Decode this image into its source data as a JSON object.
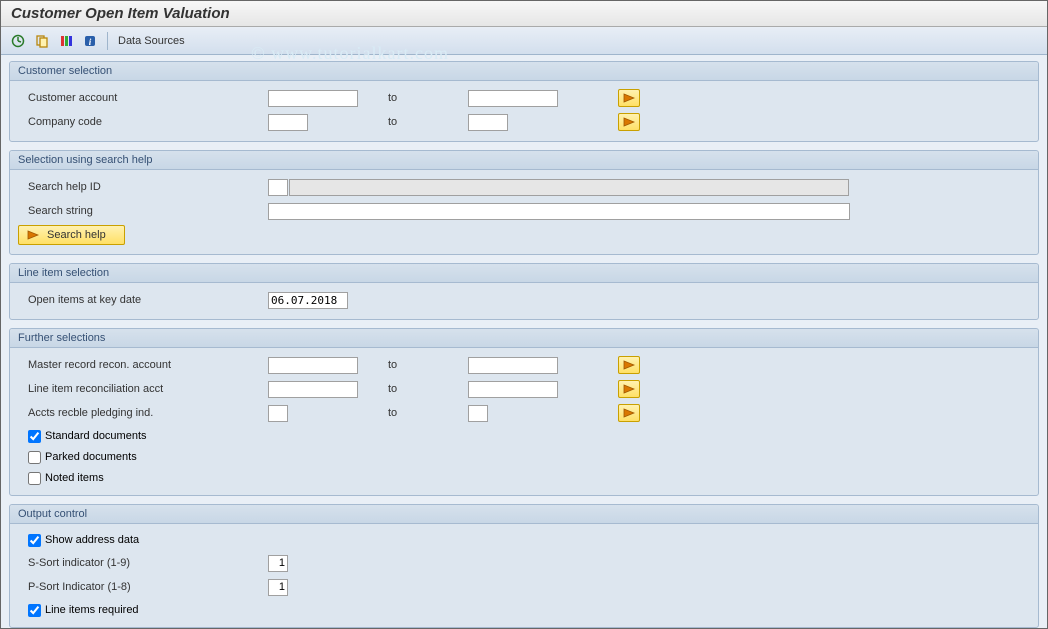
{
  "title": "Customer Open Item Valuation",
  "toolbar": {
    "data_sources": "Data Sources"
  },
  "watermark": "© www.tutorialkart.com",
  "groups": {
    "customer_selection": {
      "title": "Customer selection",
      "customer_account_label": "Customer account",
      "company_code_label": "Company code",
      "to_label": "to"
    },
    "search_help": {
      "title": "Selection using search help",
      "search_help_id_label": "Search help ID",
      "search_string_label": "Search string",
      "search_help_btn": "Search help"
    },
    "line_item_selection": {
      "title": "Line item selection",
      "open_items_label": "Open items at key date",
      "open_items_value": "06.07.2018"
    },
    "further_selections": {
      "title": "Further selections",
      "master_record_label": "Master record recon. account",
      "line_item_recon_label": "Line item reconciliation acct",
      "accts_recble_label": "Accts recble pledging ind.",
      "to_label": "to",
      "standard_docs_label": "Standard documents",
      "parked_docs_label": "Parked documents",
      "noted_items_label": "Noted items"
    },
    "output_control": {
      "title": "Output control",
      "show_address_label": "Show address data",
      "s_sort_label": "S-Sort indicator (1-9)",
      "s_sort_value": "1",
      "p_sort_label": "P-Sort Indicator (1-8)",
      "p_sort_value": "1",
      "line_items_required_label": "Line items required"
    }
  }
}
